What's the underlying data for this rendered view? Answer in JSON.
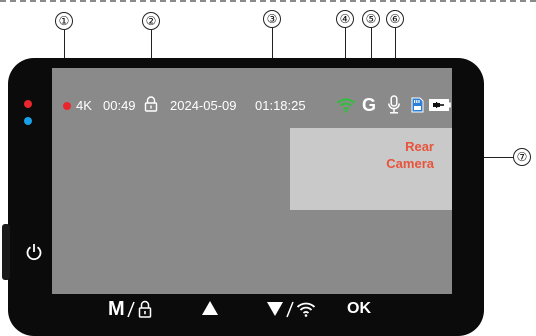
{
  "callouts": [
    "①",
    "②",
    "③",
    "④",
    "⑤",
    "⑥",
    "⑦"
  ],
  "status_bar": {
    "resolution": "4K",
    "rec_time": "00:49",
    "date": "2024-05-09",
    "time": "01:18:25",
    "gps_label": "G"
  },
  "rear_camera": {
    "line1": "Rear",
    "line2": "Camera"
  },
  "buttons": {
    "mode_label": "M",
    "ok_label": "OK"
  },
  "colors": {
    "rec_dot": "#e8262b",
    "wifi": "#2fbf3a",
    "rear_text": "#e8533b",
    "screen": "#8a8a8a"
  },
  "icons": [
    "recording-dot-icon",
    "lock-icon",
    "wifi-icon",
    "microphone-icon",
    "sd-card-icon",
    "battery-icon",
    "power-icon",
    "up-arrow-icon",
    "down-arrow-icon"
  ]
}
